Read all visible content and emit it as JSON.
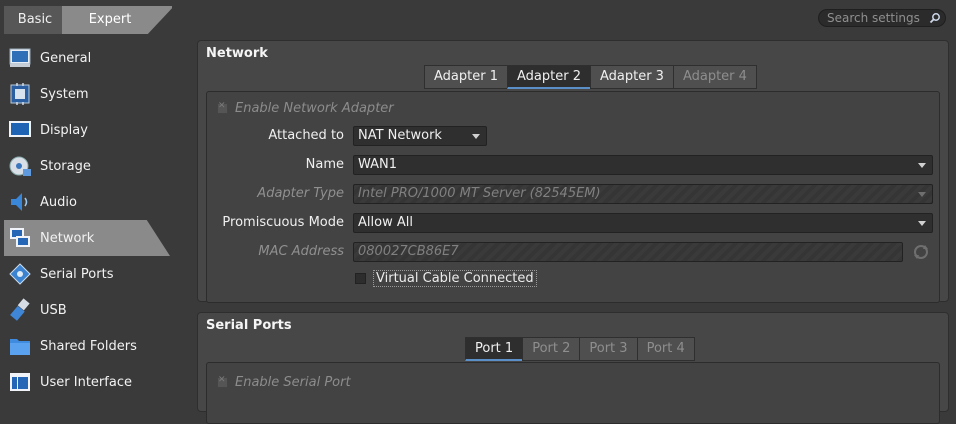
{
  "mode_tabs": {
    "basic": "Basic",
    "expert": "Expert"
  },
  "search": {
    "placeholder": "Search settings"
  },
  "sidebar": {
    "items": [
      {
        "label": "General",
        "icon": "general-icon"
      },
      {
        "label": "System",
        "icon": "system-icon"
      },
      {
        "label": "Display",
        "icon": "display-icon"
      },
      {
        "label": "Storage",
        "icon": "storage-icon"
      },
      {
        "label": "Audio",
        "icon": "audio-icon"
      },
      {
        "label": "Network",
        "icon": "network-icon",
        "active": true
      },
      {
        "label": "Serial Ports",
        "icon": "serial-ports-icon"
      },
      {
        "label": "USB",
        "icon": "usb-icon"
      },
      {
        "label": "Shared Folders",
        "icon": "shared-folders-icon"
      },
      {
        "label": "User Interface",
        "icon": "user-interface-icon"
      }
    ]
  },
  "network": {
    "title": "Network",
    "tabs": [
      "Adapter 1",
      "Adapter 2",
      "Adapter 3",
      "Adapter 4"
    ],
    "active_tab": "Adapter 2",
    "enable_label": "Enable Network Adapter",
    "attached_to": {
      "label": "Attached to",
      "value": "NAT Network"
    },
    "name": {
      "label": "Name",
      "value": "WAN1"
    },
    "adapter_type": {
      "label": "Adapter Type",
      "value": "Intel PRO/1000 MT Server (82545EM)"
    },
    "promiscuous": {
      "label": "Promiscuous Mode",
      "value": "Allow All"
    },
    "mac": {
      "label": "MAC Address",
      "value": "080027CB86E7"
    },
    "cable_label": "Virtual Cable Connected"
  },
  "serial": {
    "title": "Serial Ports",
    "tabs": [
      "Port 1",
      "Port 2",
      "Port 3",
      "Port 4"
    ],
    "active_tab": "Port 1",
    "enable_label": "Enable Serial Port"
  },
  "colors": {
    "accent": "#5a8fc8",
    "panel": "#474747",
    "background": "#3a3a3a"
  }
}
